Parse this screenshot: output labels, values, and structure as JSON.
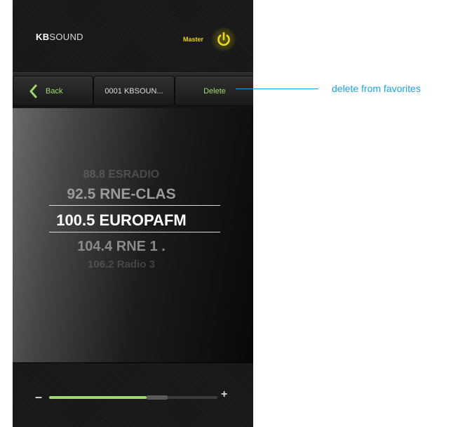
{
  "header": {
    "brand_bold": "KB",
    "brand_rest": "SOUND",
    "master_label": "Master",
    "power_icon": "power-icon",
    "master_color": "#e8d100"
  },
  "nav": {
    "back_label": "Back",
    "back_icon": "chevron-left-icon",
    "station_label": "0001 KBSOUN...",
    "delete_label": "Delete",
    "accent_color": "#9fd96e"
  },
  "dial": {
    "stations": [
      "88.8 ESRADIO",
      "92.5 RNE-CLAS",
      "100.5 EUROPAFM",
      "104.4 RNE 1 .",
      "106.2 Radio 3"
    ],
    "selected_index": 2
  },
  "volume": {
    "minus_label": "–",
    "plus_label": "+",
    "level_fraction": 0.58
  },
  "annotation": {
    "text": "delete from favorites",
    "color": "#1da1e6"
  }
}
